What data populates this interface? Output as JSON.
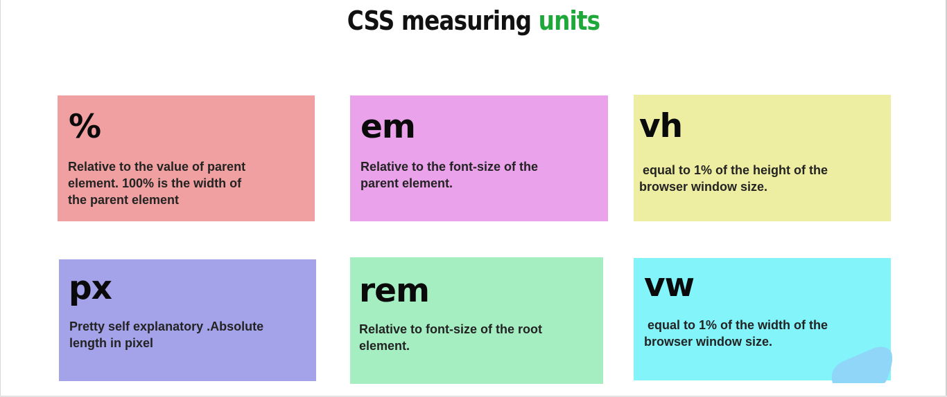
{
  "title": {
    "prefix": "CSS measuring ",
    "accent": "units",
    "accent_color": "#1fa83a"
  },
  "cards": [
    {
      "unit": "%",
      "color": "#f0a0a0",
      "desc_lines": [
        "Relative to the value of parent",
        "element. 100% is the width of",
        "the parent element"
      ]
    },
    {
      "unit": "em",
      "color": "#eaa2ea",
      "desc_lines": [
        "Relative to the font-size of the",
        "parent element."
      ]
    },
    {
      "unit": "vh",
      "color": "#eeeea2",
      "desc_lines": [
        " equal to 1% of the height of the",
        "browser window size."
      ]
    },
    {
      "unit": "px",
      "color": "#a4a2e8",
      "desc_lines": [
        "Pretty self explanatory .Absolute",
        "length in pixel"
      ]
    },
    {
      "unit": "rem",
      "color": "#a4eec2",
      "desc_lines": [
        "Relative to font-size of the root",
        "element."
      ]
    },
    {
      "unit": "vw",
      "color": "#82f4fa",
      "desc_lines": [
        " equal to 1% of the width of the",
        "browser window size."
      ]
    }
  ],
  "highlight_color": "#90d6f8"
}
